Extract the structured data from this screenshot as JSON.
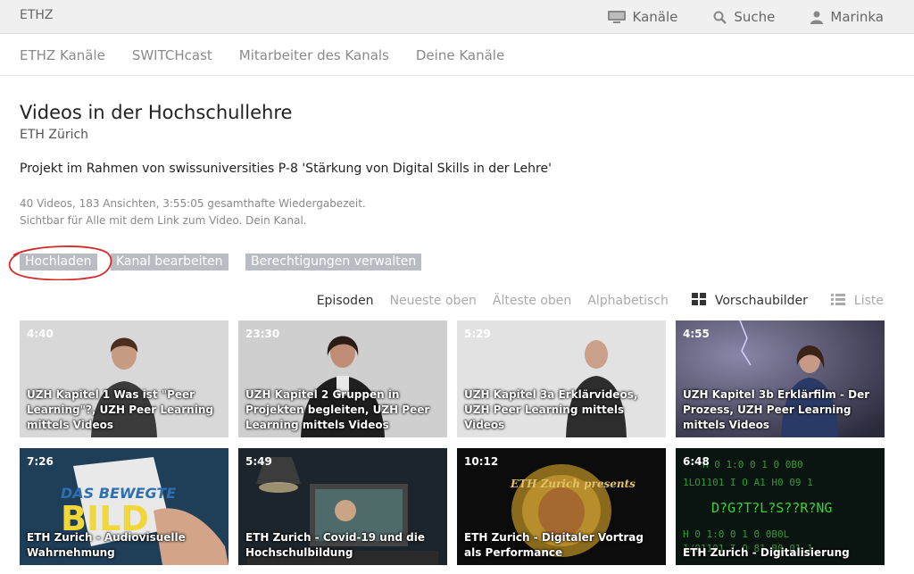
{
  "brand": "ETHZ",
  "topnav": [
    {
      "label": "Kanäle",
      "icon": "tv-icon"
    },
    {
      "label": "Suche",
      "icon": "search-icon"
    },
    {
      "label": "Marinka",
      "icon": "user-icon"
    }
  ],
  "subnav": [
    "ETHZ Kanäle",
    "SWITCHcast",
    "Mitarbeiter des Kanals",
    "Deine Kanäle"
  ],
  "channel": {
    "title": "Videos in der Hochschullehre",
    "org": "ETH Zürich",
    "description": "Projekt im Rahmen von swissuniversities P-8 'Stärkung von Digital Skills in der Lehre'",
    "stats": "40 Videos, 183 Ansichten, 3:55:05 gesamthafte Wiedergabezeit.",
    "visibility": "Sichtbar für Alle mit dem Link zum Video. Dein Kanal."
  },
  "actions": {
    "upload": "Hochladen",
    "edit": "Kanal bearbeiten",
    "permissions": "Berechtigungen verwalten"
  },
  "sort": {
    "label": "Episoden",
    "options": [
      "Neueste oben",
      "Älteste oben",
      "Alphabetisch"
    ]
  },
  "view": {
    "thumbnails": "Vorschaubilder",
    "list": "Liste",
    "active": "thumbnails"
  },
  "videos": [
    {
      "duration": "4:40",
      "title": "UZH Kapitel 1 Was ist \"Peer Learning\"?, UZH Peer Learning mittels Videos"
    },
    {
      "duration": "23:30",
      "title": "UZH Kapitel 2 Gruppen in Projekten begleiten, UZH Peer Learning mittels Videos"
    },
    {
      "duration": "5:29",
      "title": "UZH Kapitel 3a Erklärvideos, UZH Peer Learning mittels Videos"
    },
    {
      "duration": "4:55",
      "title": "UZH Kapitel 3b Erklärfilm - Der Prozess, UZH Peer Learning mittels Videos"
    },
    {
      "duration": "7:26",
      "title": "ETH Zurich - Audiovisuelle Wahrnehmung",
      "thumb_text": "DAS BEWEGTE BILD"
    },
    {
      "duration": "5:49",
      "title": "ETH Zurich - Covid-19 und die Hochschulbildung"
    },
    {
      "duration": "10:12",
      "title": "ETH Zurich - Digitaler Vortrag als Performance",
      "thumb_text": "ETH Zurich presents"
    },
    {
      "duration": "6:48",
      "title": "ETH Zurich - Digitalisierung",
      "thumb_text": "D?G?T?L?S??R?NG"
    }
  ],
  "colors": {
    "topbar": "#f0f0f0",
    "button": "#b9bcc2",
    "annotation": "#d42a2a",
    "matrix_green": "#35d235"
  }
}
